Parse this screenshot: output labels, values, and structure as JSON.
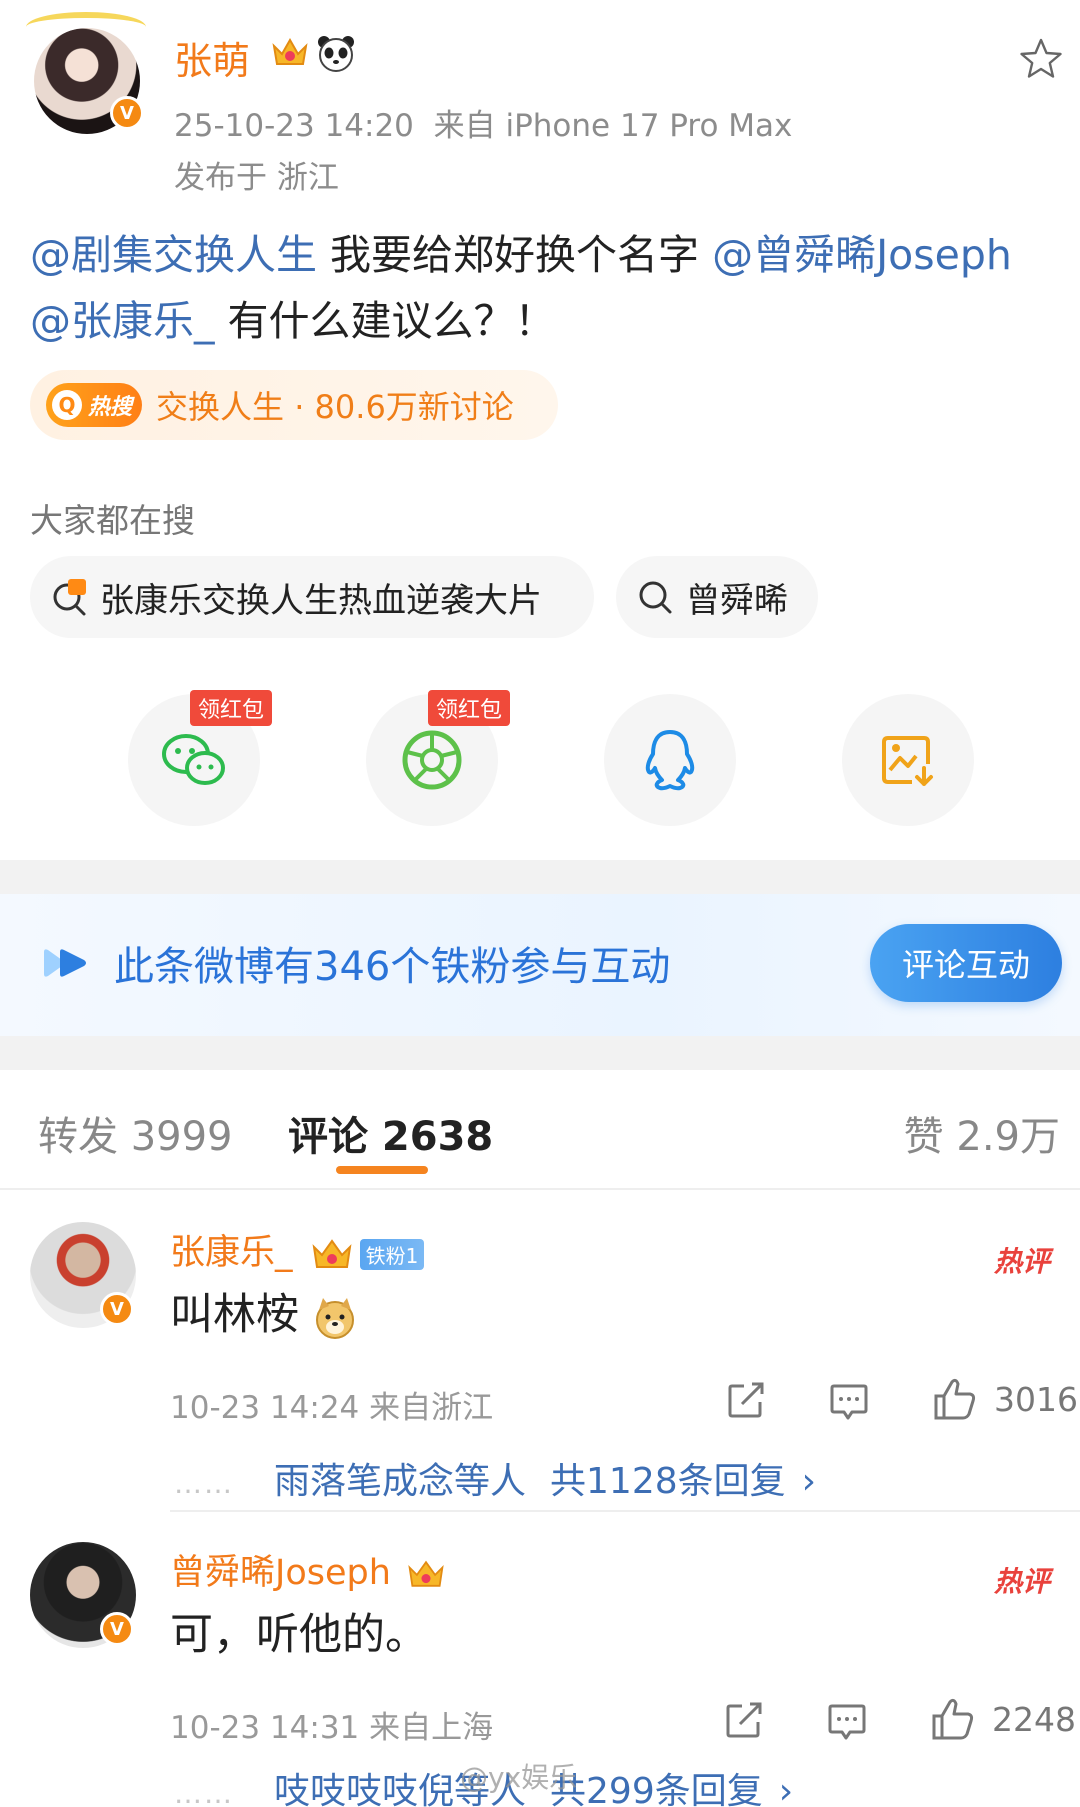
{
  "post": {
    "author": "张萌",
    "timestamp": "25-10-23 14:20",
    "source": "来自 iPhone 17 Pro Max",
    "location": "发布于 浙江",
    "content": {
      "mention1": "@剧集交换人生",
      "text1": " 我要给郑好换个名字 ",
      "mention2": "@曾舜晞Joseph",
      "text2": " ",
      "mention3": "@张康乐_",
      "text3": " 有什么建议么？！"
    },
    "hot_search": {
      "badge": "热搜",
      "topic": "交换人生",
      "separator": "·",
      "discussion": "80.6万新讨论"
    }
  },
  "related_search": {
    "title": "大家都在搜",
    "chips": [
      "张康乐交换人生热血逆袭大片",
      "曾舜晞"
    ]
  },
  "share": {
    "items": [
      {
        "name": "wechat",
        "icon": "wechat-icon",
        "tag": "领红包"
      },
      {
        "name": "moments",
        "icon": "moments-icon",
        "tag": "领红包"
      },
      {
        "name": "qq",
        "icon": "qq-icon",
        "tag": ""
      },
      {
        "name": "save-image",
        "icon": "save-image-icon",
        "tag": ""
      }
    ]
  },
  "fan_banner": {
    "text": "此条微博有346个铁粉参与互动",
    "button": "评论互动"
  },
  "tabs": {
    "repost": "转发 3999",
    "comment": "评论 2638",
    "like": "赞 2.9万",
    "active": "comment"
  },
  "comments": [
    {
      "user": "张康乐_",
      "fan_badge": "铁粉1",
      "text": "叫林桉",
      "time": "10-23 14:24",
      "location": "来自浙江",
      "hot_tag": "热评",
      "likes": "3016",
      "reply_dots": "……",
      "reply_who": "雨落笔成念等人",
      "reply_count": "共1128条回复",
      "reply_arrow": "›"
    },
    {
      "user": "曾舜晞Joseph",
      "fan_badge": "",
      "text": "可，听他的。",
      "time": "10-23 14:31",
      "location": "来自上海",
      "hot_tag": "热评",
      "likes": "2248",
      "reply_dots": "……",
      "reply_who": "吱吱吱吱倪等人",
      "reply_count": "共299条回复",
      "reply_arrow": "›"
    }
  ],
  "watermark": "@yx娱乐"
}
